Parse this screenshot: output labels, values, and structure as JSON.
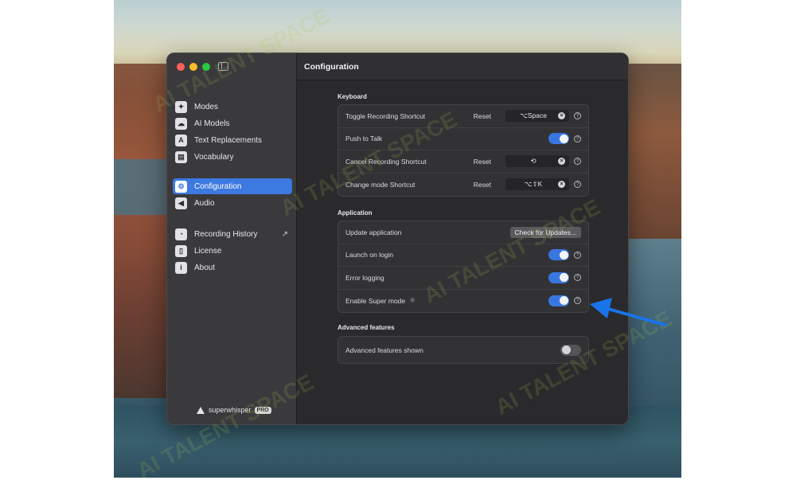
{
  "window_title": "Configuration",
  "sidebar": {
    "groups": [
      [
        {
          "label": "Modes",
          "icon": "✦",
          "icon_name": "modes-icon"
        },
        {
          "label": "AI Models",
          "icon": "☁",
          "icon_name": "ai-models-icon"
        },
        {
          "label": "Text Replacements",
          "icon": "A",
          "icon_name": "text-replacements-icon"
        },
        {
          "label": "Vocabulary",
          "icon": "▤",
          "icon_name": "vocabulary-icon"
        }
      ],
      [
        {
          "label": "Configuration",
          "icon": "⚙",
          "icon_name": "gear-icon",
          "active": true
        },
        {
          "label": "Audio",
          "icon": "◀",
          "icon_name": "speaker-icon"
        }
      ],
      [
        {
          "label": "Recording History",
          "icon": "◔",
          "icon_name": "history-icon",
          "external": "↗"
        },
        {
          "label": "License",
          "icon": "▯",
          "icon_name": "license-icon"
        },
        {
          "label": "About",
          "icon": "i",
          "icon_name": "info-icon"
        }
      ]
    ],
    "brand": {
      "name": "superwhisper",
      "badge": "PRO"
    }
  },
  "sections": {
    "keyboard": {
      "title": "Keyboard",
      "rows": {
        "toggle_recording": {
          "label": "Toggle Recording Shortcut",
          "reset": "Reset",
          "shortcut": "⌥Space"
        },
        "push_to_talk": {
          "label": "Push to Talk",
          "enabled": true
        },
        "cancel_recording": {
          "label": "Cancel Recording Shortcut",
          "reset": "Reset",
          "shortcut": "⟲"
        },
        "change_mode": {
          "label": "Change mode Shortcut",
          "reset": "Reset",
          "shortcut": "⌥⇧K"
        }
      }
    },
    "application": {
      "title": "Application",
      "rows": {
        "update": {
          "label": "Update application",
          "button": "Check for Updates..."
        },
        "launch_on_login": {
          "label": "Launch on login",
          "enabled": true
        },
        "error_logging": {
          "label": "Error logging",
          "enabled": true
        },
        "super_mode": {
          "label": "Enable Super mode",
          "enabled": true
        }
      }
    },
    "advanced": {
      "title": "Advanced features",
      "rows": {
        "advanced_shown": {
          "label": "Advanced features shown",
          "enabled": false
        }
      }
    }
  },
  "watermark": "AI TALENT SPACE",
  "colors": {
    "accent": "#3c79e0",
    "arrow": "#1a73e8"
  }
}
